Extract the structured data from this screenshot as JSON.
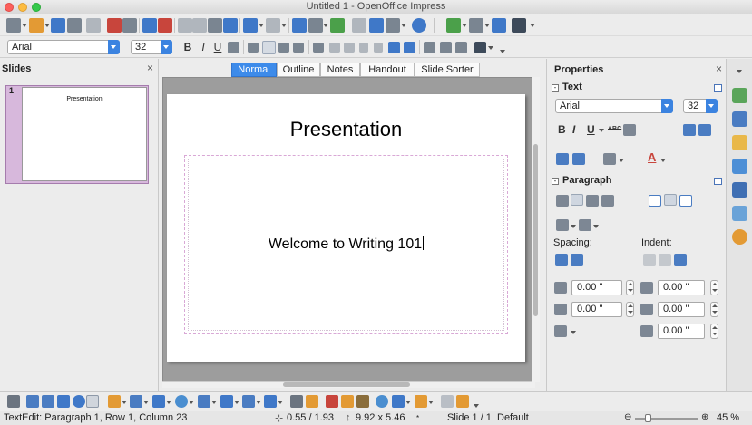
{
  "window": {
    "title": "Untitled 1 - OpenOffice Impress"
  },
  "format_toolbar": {
    "font_name": "Arial",
    "font_size": "32",
    "bold_label": "B",
    "italic_label": "I",
    "underline_label": "U"
  },
  "slides_panel": {
    "title": "Slides",
    "close_label": "×",
    "thumbnails": [
      {
        "number": "1",
        "title": "Presentation"
      }
    ]
  },
  "view_tabs": [
    "Normal",
    "Outline",
    "Notes",
    "Handout",
    "Slide Sorter"
  ],
  "active_view": "Normal",
  "slide": {
    "title": "Presentation",
    "body": "Welcome to Writing 101"
  },
  "properties": {
    "title": "Properties",
    "close_label": "×",
    "text_section": {
      "title": "Text",
      "font_name": "Arial",
      "font_size": "32",
      "bold_label": "B",
      "italic_label": "I",
      "underline_label": "U",
      "strike_label": "ABC",
      "font_color_label": "A"
    },
    "paragraph_section": {
      "title": "Paragraph",
      "spacing_label": "Spacing:",
      "indent_label": "Indent:",
      "above_spacing": "0.00 \"",
      "below_spacing": "0.00 \"",
      "before_indent": "0.00 \"",
      "after_indent": "0.00 \"",
      "first_line_indent": "0.00 \""
    }
  },
  "status": {
    "mode": "TextEdit: Paragraph 1, Row 1, Column 23",
    "position": "0.55 / 1.93",
    "size": "9.92 x 5.46",
    "slide": "Slide 1 / 1",
    "layout": "Default",
    "zoom": "45 %"
  },
  "colors": {
    "accent": "#3d8bea",
    "slide_selection": "#d7b8dc",
    "font_color": "#c8453c"
  },
  "icons": [
    "new-icon",
    "open-icon",
    "save-icon",
    "email-icon",
    "edit-file-icon",
    "export-pdf-icon",
    "print-icon",
    "spellcheck-icon",
    "autospellcheck-icon",
    "cut-icon",
    "copy-icon",
    "paste-icon",
    "clone-format-icon",
    "undo-icon",
    "redo-icon",
    "chart-icon",
    "table-icon",
    "navigator-icon",
    "grid-icon",
    "show-draw-icon",
    "zoom-icon",
    "help-icon",
    "slide-icon",
    "slide-layout-icon",
    "slideshow-icon",
    "shadow-icon",
    "align-left-icon",
    "align-center-icon",
    "align-right-icon",
    "justify-icon",
    "bullets-icon",
    "select-icon",
    "line-icon",
    "arrow-line-icon",
    "rectangle-icon",
    "ellipse-icon",
    "text-icon",
    "curve-icon",
    "connector-icon",
    "basic-shapes-icon",
    "symbol-shapes-icon",
    "block-arrows-icon",
    "flowchart-icon",
    "callouts-icon",
    "stars-icon",
    "points-icon",
    "glue-icon",
    "fontwork-icon",
    "from-file-icon",
    "gallery-icon",
    "rotate-icon",
    "alignment-icon",
    "arrange-icon",
    "extrusion-icon",
    "effects-icon"
  ]
}
